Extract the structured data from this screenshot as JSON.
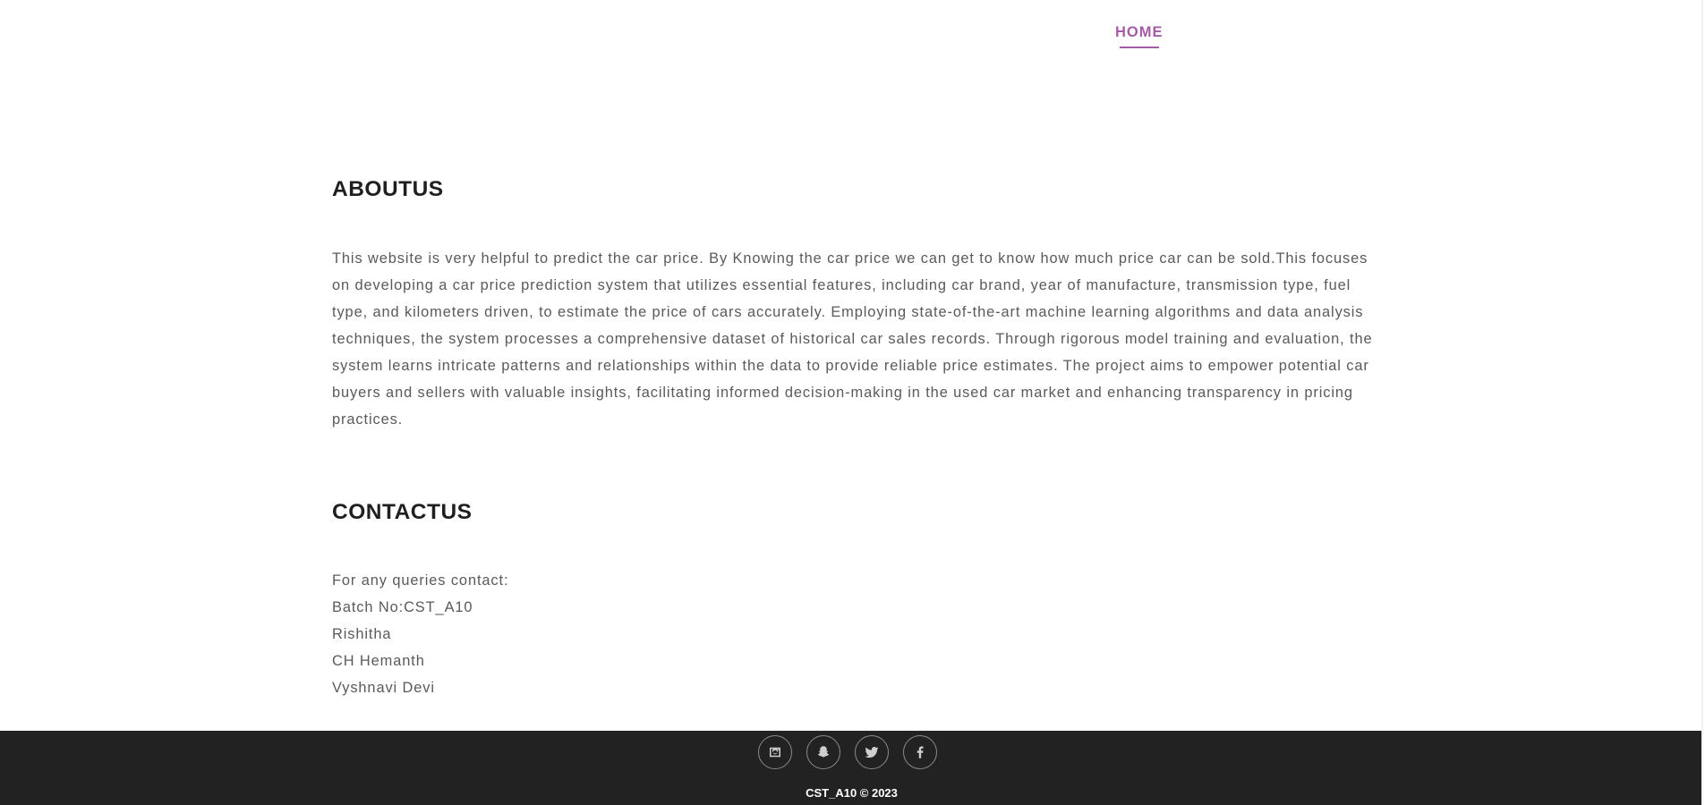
{
  "nav": {
    "home_label": "HOME"
  },
  "about": {
    "title": "ABOUTUS",
    "text": "This website is very helpful to predict the car price. By Knowing the car price we can get to know how much price car can be sold.This focuses on developing a car price prediction system that utilizes essential features, including car brand, year of manufacture, transmission type, fuel type, and kilometers driven, to estimate the price of cars accurately. Employing state-of-the-art machine learning algorithms and data analysis techniques, the system processes a comprehensive dataset of historical car sales records. Through rigorous model training and evaluation, the system learns intricate patterns and relationships within the data to provide reliable price estimates. The project aims to empower potential car buyers and sellers with valuable insights, facilitating informed decision-making in the used car market and enhancing transparency in pricing practices."
  },
  "contact": {
    "title": "CONTACTUS",
    "lines": [
      "For any queries contact:",
      "Batch No:CST_A10",
      "Rishitha",
      "CH Hemanth",
      "Vyshnavi Devi"
    ]
  },
  "footer": {
    "social_icons": [
      "instagram-icon",
      "snapchat-icon",
      "twitter-icon",
      "facebook-icon"
    ],
    "copyright": "CST_A10 © 2023"
  },
  "colors": {
    "accent": "#a55ca6",
    "footer_bg": "#222222",
    "heading": "#1f1f1f",
    "body_text": "#5a5a5a"
  }
}
